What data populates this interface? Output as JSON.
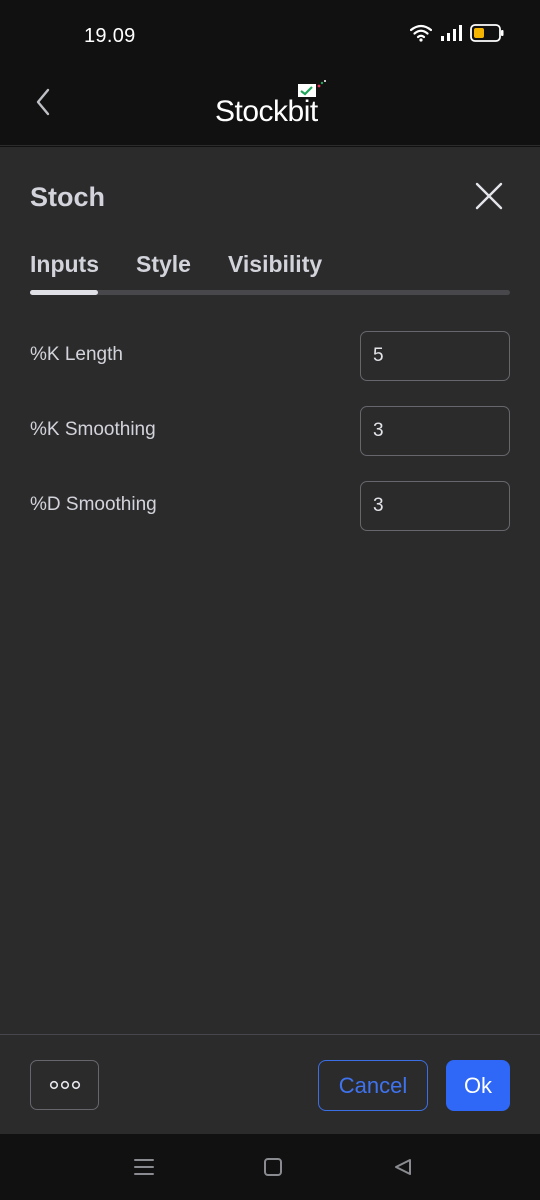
{
  "status_bar": {
    "time": "19.09",
    "icons": [
      "wifi-icon",
      "signal-icon",
      "battery-icon"
    ],
    "battery_color": "#f4b400"
  },
  "header": {
    "logo_text": "Stockbit",
    "back_icon": "chevron-left-icon"
  },
  "dialog": {
    "title": "Stoch",
    "tabs": [
      {
        "label": "Inputs",
        "active": true
      },
      {
        "label": "Style",
        "active": false
      },
      {
        "label": "Visibility",
        "active": false
      }
    ],
    "fields": [
      {
        "label": "%K Length",
        "value": "5"
      },
      {
        "label": "%K Smoothing",
        "value": "3"
      },
      {
        "label": "%D Smoothing",
        "value": "3"
      }
    ],
    "footer": {
      "more_icon": "more-dots-icon",
      "cancel_label": "Cancel",
      "ok_label": "Ok"
    }
  },
  "nav_bar": {
    "icons": [
      "menu-icon",
      "home-square-icon",
      "back-triangle-icon"
    ]
  },
  "colors": {
    "background": "#2b2b2c",
    "accent": "#2f68f6",
    "text": "#d3d4db"
  }
}
